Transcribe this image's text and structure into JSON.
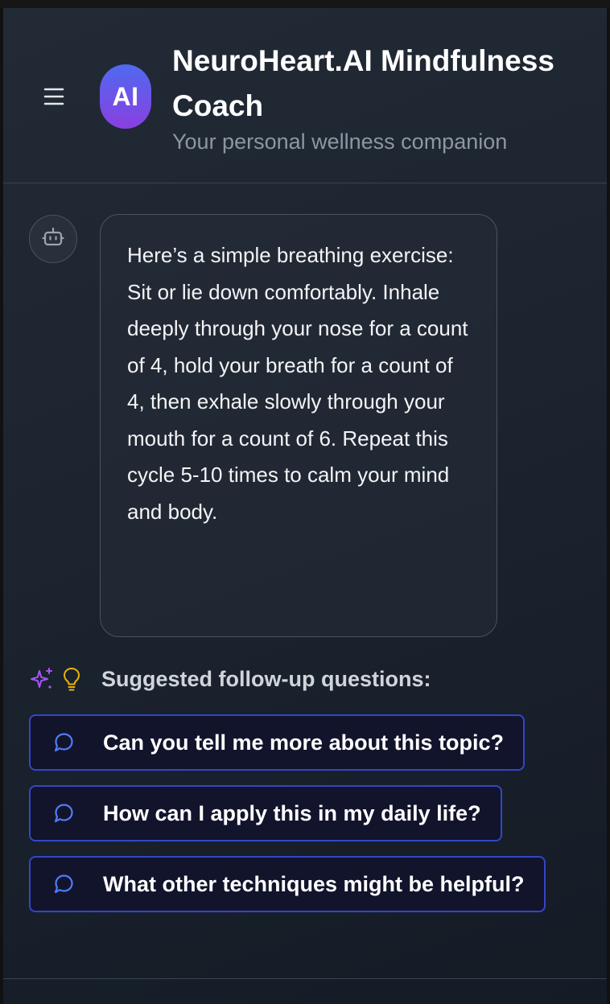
{
  "header": {
    "menu_icon": "hamburger-menu-icon",
    "avatar_text": "AI",
    "title": "NeuroHeart.AI Mindfulness Coach",
    "subtitle": "Your personal wellness companion"
  },
  "chat": {
    "messages": [
      {
        "role": "assistant",
        "avatar_icon": "bot-icon",
        "text": "Here’s a simple breathing exercise: Sit or lie down comfortably. Inhale deeply through your nose for a count of 4, hold your breath for a count of 4, then exhale slowly through your mouth for a count of 6. Repeat this cycle 5-10 times to calm your mind and body."
      }
    ]
  },
  "suggestions": {
    "icons": [
      "sparkles-icon",
      "lightbulb-icon"
    ],
    "label": "Suggested follow-up questions:",
    "items": [
      {
        "icon": "chat-bubble-icon",
        "label": "Can you tell me more about this topic?"
      },
      {
        "icon": "chat-bubble-icon",
        "label": "How can I apply this in my daily life?"
      },
      {
        "icon": "chat-bubble-icon",
        "label": "What other techniques might be helpful?"
      }
    ]
  },
  "colors": {
    "avatar_gradient_start": "#4f6af0",
    "avatar_gradient_end": "#8a3fe0",
    "chip_border": "#3346c8",
    "chip_icon": "#4f7cf7",
    "sparkle": "#a855f7",
    "bulb": "#eab308"
  }
}
